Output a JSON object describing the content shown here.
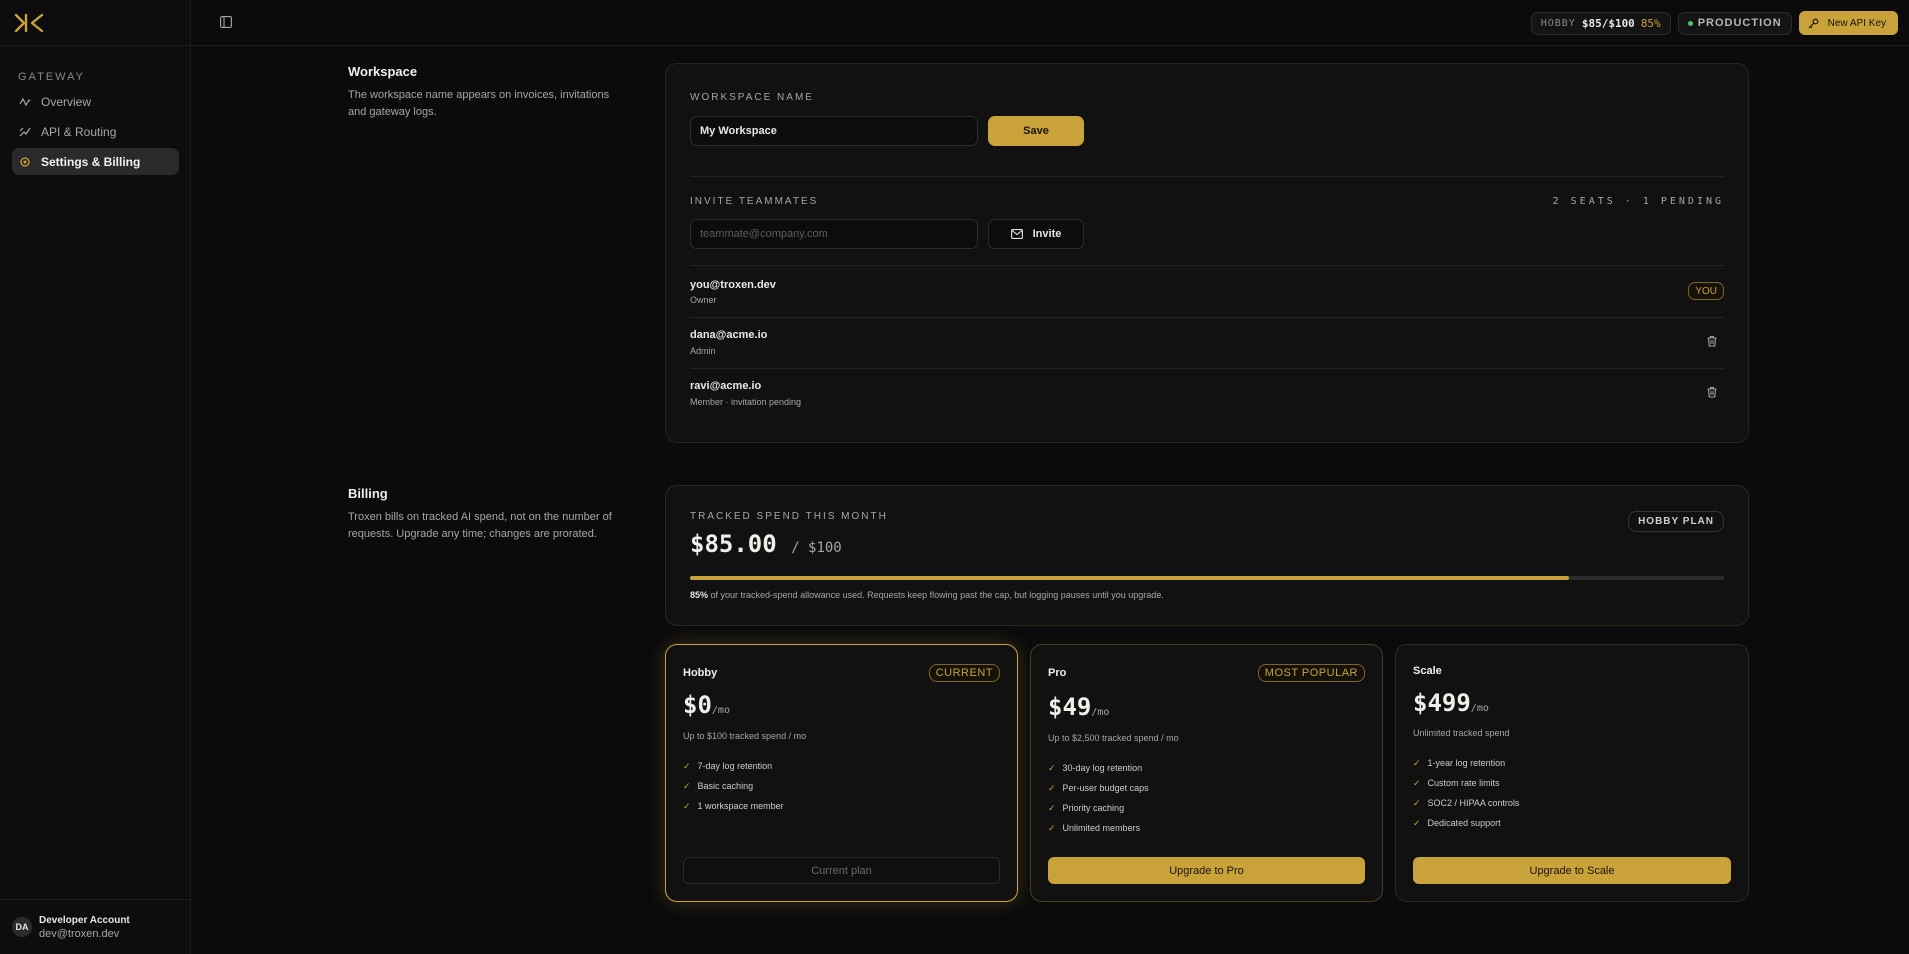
{
  "sidebar": {
    "section_label": "GATEWAY",
    "items": [
      {
        "label": "Overview",
        "icon": "activity-icon"
      },
      {
        "label": "API & Routing",
        "icon": "route-icon"
      },
      {
        "label": "Settings & Billing",
        "icon": "gear-icon"
      }
    ],
    "account": {
      "initials": "DA",
      "name": "Developer Account",
      "email": "dev@troxen.dev"
    }
  },
  "header": {
    "plan_pill": {
      "plan": "HOBBY",
      "spend": "$85/$100",
      "percent": "85%"
    },
    "environment": "PRODUCTION",
    "new_key_label": "New API Key"
  },
  "workspace": {
    "title": "Workspace",
    "description": "The workspace name appears on invoices, invitations and gateway logs.",
    "name_label": "WORKSPACE NAME",
    "name_value": "My Workspace",
    "save_label": "Save",
    "invite_label": "INVITE TEAMMATES",
    "seats_info": "2 SEATS · 1 PENDING",
    "invite_placeholder": "teammate@company.com",
    "invite_button": "Invite",
    "members": [
      {
        "email": "you@troxen.dev",
        "role": "Owner",
        "badge": "YOU"
      },
      {
        "email": "dana@acme.io",
        "role": "Admin"
      },
      {
        "email": "ravi@acme.io",
        "role": "Member · invitation pending"
      }
    ]
  },
  "billing": {
    "title": "Billing",
    "description": "Troxen bills on tracked AI spend, not on the number of requests. Upgrade any time; changes are prorated.",
    "spend_label": "TRACKED SPEND THIS MONTH",
    "spend_value": "$85.00",
    "spend_cap": "/ $100",
    "plan_badge": "HOBBY PLAN",
    "usage_fraction": 0.85,
    "usage_percent": "85%",
    "usage_note": "of your tracked-spend allowance used. Requests keep flowing past the cap, but logging pauses until you upgrade.",
    "plans": [
      {
        "name": "Hobby",
        "badge": "CURRENT",
        "price": "$0",
        "per": "/mo",
        "sub": "Up to $100 tracked spend / mo",
        "features": [
          "7-day log retention",
          "Basic caching",
          "1 workspace member"
        ],
        "button": "Current plan"
      },
      {
        "name": "Pro",
        "badge": "MOST POPULAR",
        "price": "$49",
        "per": "/mo",
        "sub": "Up to $2,500 tracked spend / mo",
        "features": [
          "30-day log retention",
          "Per-user budget caps",
          "Priority caching",
          "Unlimited members"
        ],
        "button": "Upgrade to Pro"
      },
      {
        "name": "Scale",
        "price": "$499",
        "per": "/mo",
        "sub": "Unlimited tracked spend",
        "features": [
          "1-year log retention",
          "Custom rate limits",
          "SOC2 / HIPAA controls",
          "Dedicated support"
        ],
        "button": "Upgrade to Scale"
      }
    ]
  },
  "colors": {
    "accent": "#c9a23a",
    "background": "#0b0b0c",
    "status_ok": "#4cc16e"
  }
}
